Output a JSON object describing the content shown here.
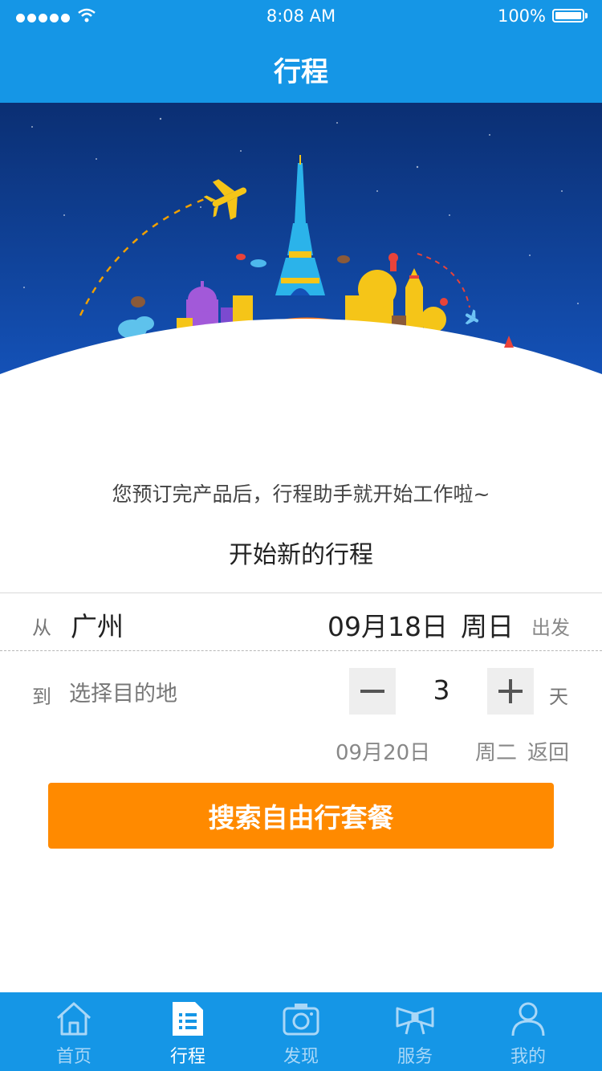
{
  "status_bar": {
    "time": "8:08 AM",
    "battery": "100%"
  },
  "nav": {
    "title": "行程"
  },
  "hint": "您预订完产品后，行程助手就开始工作啦~",
  "subtitle": "开始新的行程",
  "from": {
    "label": "从",
    "city": "广州",
    "date": "09月18日",
    "weekday": "周日",
    "action": "出发"
  },
  "to": {
    "label": "到",
    "placeholder": "选择目的地"
  },
  "stepper": {
    "minus": "−",
    "value": "3",
    "plus": "+",
    "unit": "天"
  },
  "return": {
    "date": "09月20日",
    "weekday": "周二",
    "action": "返回"
  },
  "search_button": "搜索自由行套餐",
  "tabs": [
    {
      "label": "首页",
      "icon": "home-icon"
    },
    {
      "label": "行程",
      "icon": "itinerary-icon"
    },
    {
      "label": "发现",
      "icon": "camera-icon"
    },
    {
      "label": "服务",
      "icon": "service-icon"
    },
    {
      "label": "我的",
      "icon": "profile-icon"
    }
  ],
  "colors": {
    "primary": "#1596e6",
    "accent": "#ff8a00",
    "hero_sky": "#0b3a8c"
  }
}
